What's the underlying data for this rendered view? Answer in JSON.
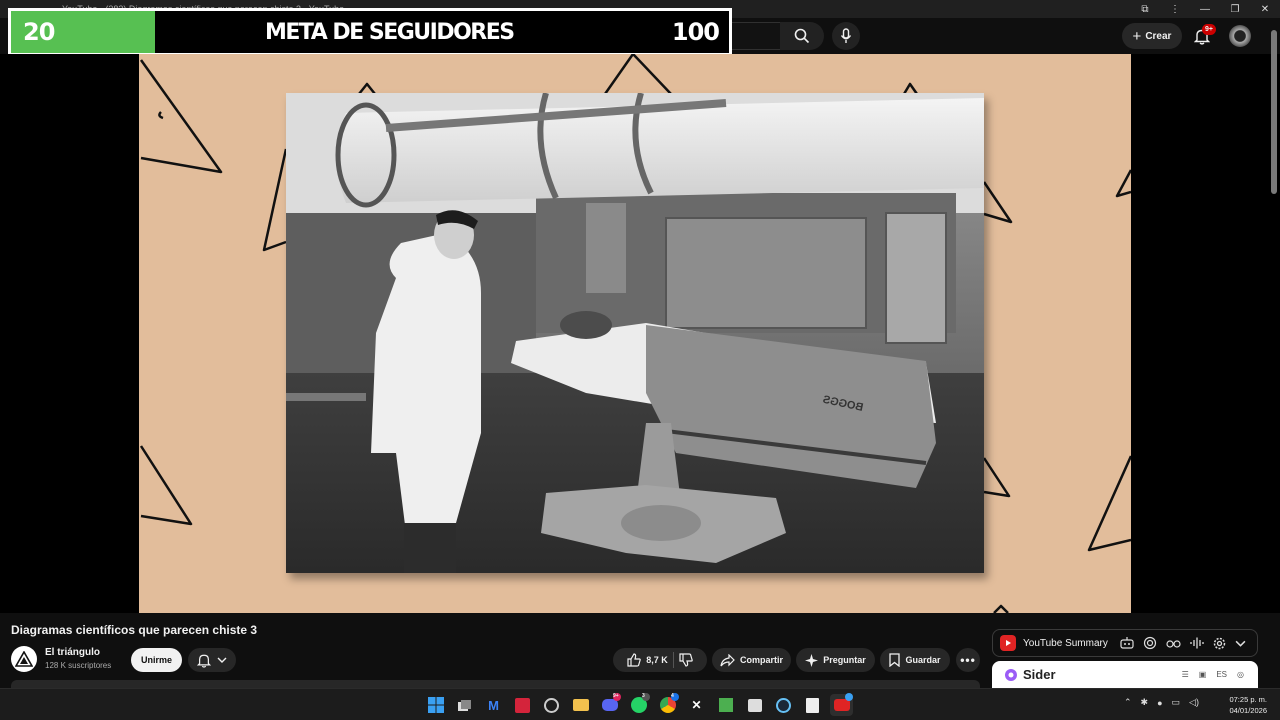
{
  "browser": {
    "tab_title": "YouTube - (383) Diagramas científicos que parecen chiste 3 - YouTube"
  },
  "header": {
    "create_label": "Crear",
    "notifications_badge": "9+"
  },
  "overlay": {
    "current": "20",
    "label": "META DE SEGUIDORES",
    "goal": "100",
    "progress_fraction": 0.2,
    "fill_color": "#57c052"
  },
  "video": {
    "title": "Diagramas científicos que parecen chiste 3",
    "photo_caption": "BOGGS",
    "background_color": "#e2bd9b"
  },
  "channel": {
    "name": "El triángulo",
    "subscribers": "128 K suscriptores",
    "join_label": "Unirme"
  },
  "actions": {
    "likes": "8,7 K",
    "share_label": "Compartir",
    "ask_label": "Preguntar",
    "save_label": "Guardar"
  },
  "extension": {
    "name": "YouTube Summary",
    "sider_name": "Sider",
    "sider_lang": "ES"
  },
  "taskbar": {
    "badge_discord": "9+",
    "badge_whatsapp": "3",
    "badge_chrome": "4",
    "time": "07:25 p. m.",
    "date": "04/01/2026"
  }
}
